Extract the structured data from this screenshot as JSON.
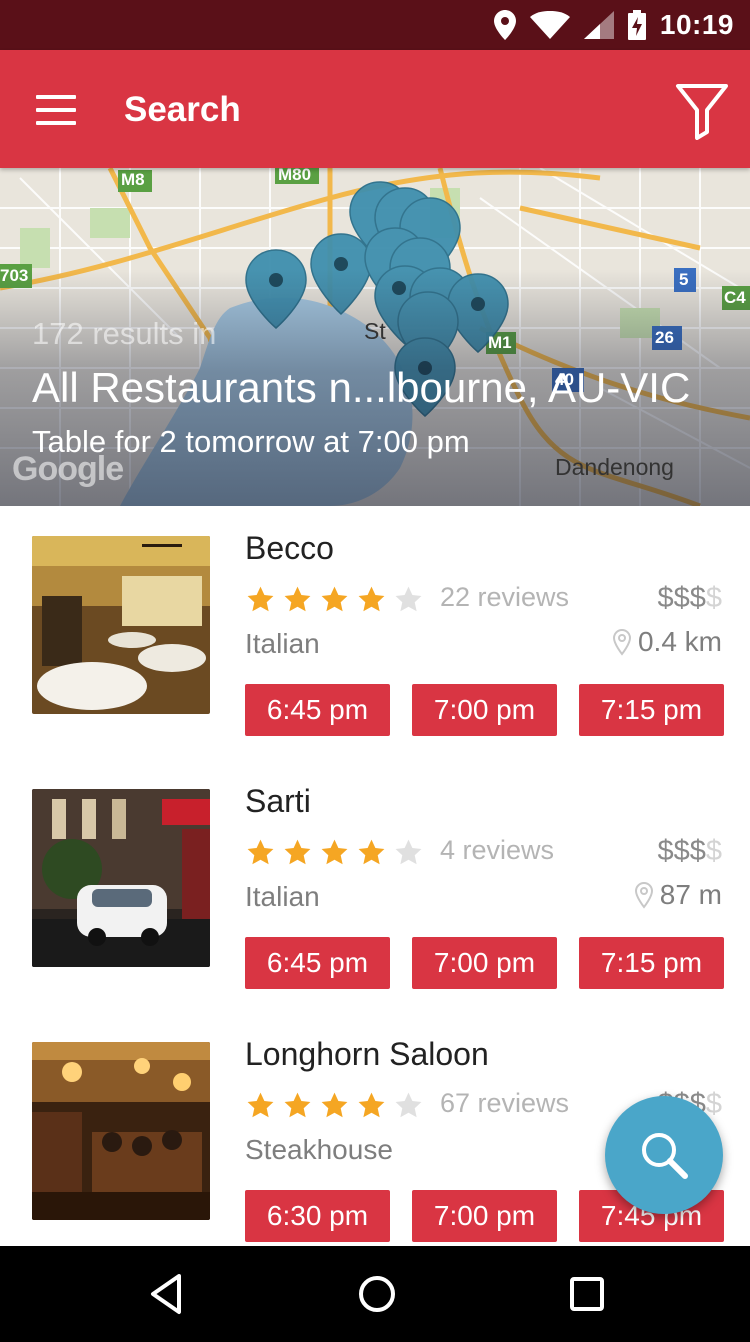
{
  "status_bar": {
    "time": "10:19"
  },
  "toolbar": {
    "title": "Search"
  },
  "map": {
    "results_count": "172 results in",
    "location": "All Restaurants n...lbourne, AU-VIC",
    "table": "Table for 2 tomorrow at 7:00 pm",
    "labels": {
      "m8": "M8",
      "m80": "M80",
      "r703": "703",
      "r5": "5",
      "c4": "C4",
      "m1": "M1",
      "r26": "26",
      "r40": "40",
      "st": "St",
      "dandenong": "Dandenong"
    },
    "logo": "Google"
  },
  "restaurants": [
    {
      "name": "Becco",
      "rating": 4,
      "reviews": "22 reviews",
      "price": "$$$",
      "price_dim": "$",
      "cuisine": "Italian",
      "distance": "0.4 km",
      "slots": [
        "6:45 pm",
        "7:00 pm",
        "7:15 pm"
      ]
    },
    {
      "name": "Sarti",
      "rating": 4,
      "reviews": "4 reviews",
      "price": "$$$",
      "price_dim": "$",
      "cuisine": "Italian",
      "distance": "87 m",
      "slots": [
        "6:45 pm",
        "7:00 pm",
        "7:15 pm"
      ]
    },
    {
      "name": "Longhorn Saloon",
      "rating": 4,
      "reviews": "67 reviews",
      "price": "$$$",
      "price_dim": "$",
      "cuisine": "Steakhouse",
      "distance": "",
      "slots": [
        "6:30 pm",
        "7:00 pm",
        "7:45 pm"
      ]
    }
  ],
  "colors": {
    "primary": "#d93543",
    "status_bar": "#5a1018",
    "fab": "#4aa6c9",
    "star": "#f5a623"
  },
  "icons": {
    "menu": "menu-icon",
    "filter": "filter-icon",
    "fab": "search-icon",
    "back": "back-icon",
    "home": "home-icon",
    "recents": "recents-icon"
  }
}
